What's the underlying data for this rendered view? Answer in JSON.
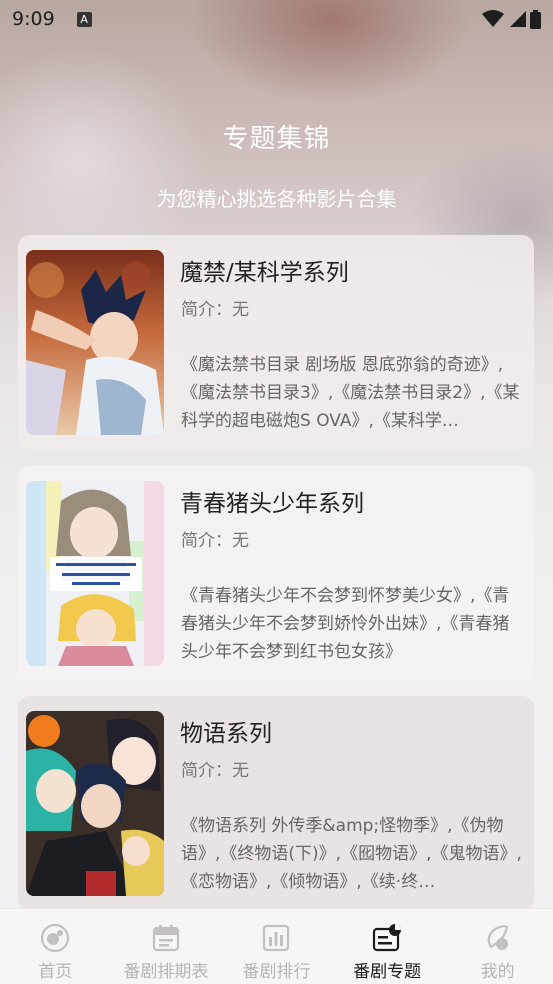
{
  "status_bar": {
    "time": "9:09",
    "a_badge": "A"
  },
  "header": {
    "title": "专题集锦",
    "subtitle": "为您精心挑选各种影片合集"
  },
  "cards": [
    {
      "title": "魔禁/某科学系列",
      "intro": "简介：无",
      "description": "《魔法禁书目录 剧场版 恩底弥翁的奇迹》,《魔法禁书目录3》,《魔法禁书目录2》,《某科学的超电磁炮S OVA》,《某科学…",
      "poster_icon": "poster-image"
    },
    {
      "title": "青春猪头少年系列",
      "intro": "简介：无",
      "description": "《青春猪头少年不会梦到怀梦美少女》,《青春猪头少年不会梦到娇怜外出妹》,《青春猪头少年不会梦到红书包女孩》",
      "poster_icon": "poster-image"
    },
    {
      "title": "物语系列",
      "intro": "简介：无",
      "description": "《物语系列 外传季&amp;怪物季》,《伪物语》,《终物语(下)》,《囮物语》,《鬼物语》,《恋物语》,《倾物语》,《续·终…",
      "poster_icon": "poster-image"
    }
  ],
  "nav": {
    "items": [
      {
        "label": "首页",
        "icon": "home-icon",
        "active": false
      },
      {
        "label": "番剧排期表",
        "icon": "calendar-icon",
        "active": false
      },
      {
        "label": "番剧排行",
        "icon": "ranking-icon",
        "active": false
      },
      {
        "label": "番剧专题",
        "icon": "topic-icon",
        "active": true
      },
      {
        "label": "我的",
        "icon": "profile-icon",
        "active": false
      }
    ]
  },
  "colors": {
    "active_nav": "#1b1b1b",
    "inactive_nav": "#b7b4b6",
    "title_text": "#222222",
    "desc_text": "#666666"
  }
}
